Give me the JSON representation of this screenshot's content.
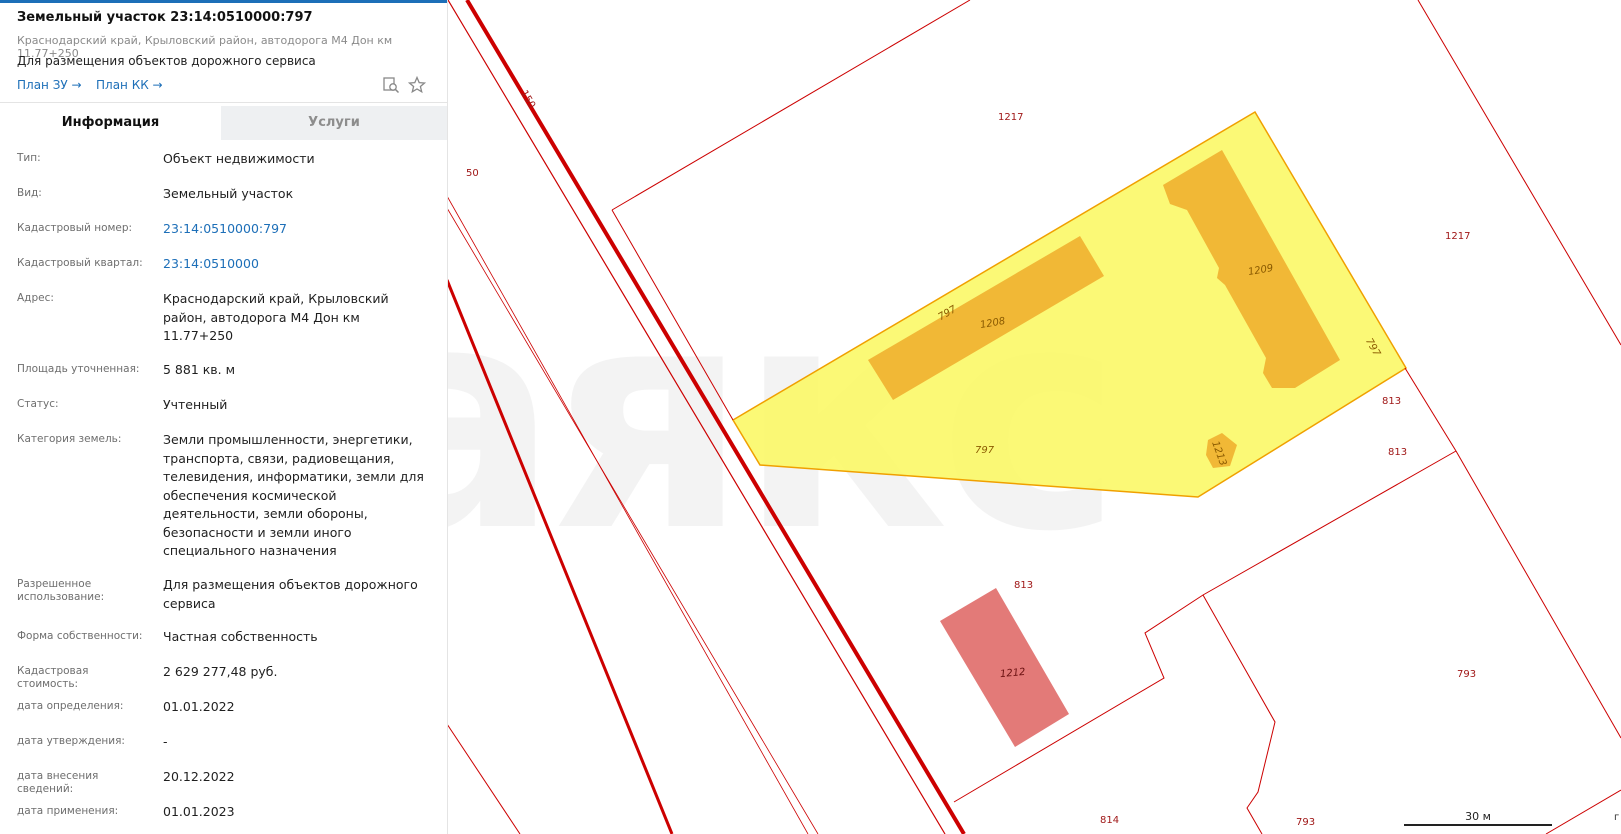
{
  "header": {
    "title": "Земельный участок 23:14:0510000:797",
    "address": "Краснодарский край, Крыловский район, автодорога М4 Дон км 11.77+250",
    "purpose": "Для размещения объектов дорожного сервиса",
    "links": [
      {
        "label": "План ЗУ →"
      },
      {
        "label": "План КК →"
      }
    ],
    "icons": [
      "search-document-icon",
      "star-icon"
    ]
  },
  "tabs": [
    {
      "label": "Информация",
      "active": true
    },
    {
      "label": "Услуги",
      "active": false
    }
  ],
  "rows": [
    {
      "key": "Тип:",
      "value": "Объект недвижимости"
    },
    {
      "key": "Вид:",
      "value": "Земельный участок"
    },
    {
      "key": "Кадастровый номер:",
      "value": "23:14:0510000:797",
      "link": true
    },
    {
      "key": "Кадастровый квартал:",
      "value": "23:14:0510000",
      "link": true
    },
    {
      "key": "Адрес:",
      "value": "Краснодарский край, Крыловский район, автодорога М4 Дон км 11.77+250"
    },
    {
      "key": "Площадь уточненная:",
      "value": "5 881 кв. м"
    },
    {
      "key": "Статус:",
      "value": "Учтенный"
    },
    {
      "key": "Категория земель:",
      "value": "Земли промышленности, энергетики, транспорта, связи, радиовещания, телевидения, информатики, земли для обеспечения космической деятельности, земли обороны, безопасности и земли иного специального назначения"
    },
    {
      "key": "Разрешенное использование:",
      "value": "Для размещения объектов дорожного сервиса"
    },
    {
      "key": "Форма собственности:",
      "value": "Частная собственность"
    },
    {
      "key": "Кадастровая стоимость:",
      "value": "2 629 277,48 руб."
    },
    {
      "key": "дата определения:",
      "value": "01.01.2022"
    },
    {
      "key": "дата утверждения:",
      "value": "-"
    },
    {
      "key": "дата внесения сведений:",
      "value": "20.12.2022"
    },
    {
      "key": "дата применения:",
      "value": "01.01.2023"
    }
  ],
  "map": {
    "watermark": "аякс",
    "labels": [
      "1217",
      "1217",
      "50",
      "150",
      "797",
      "797",
      "797",
      "1208",
      "1209",
      "1213",
      "813",
      "813",
      "813",
      "1212",
      "793",
      "814",
      "793"
    ],
    "scale": "30 м",
    "edge_label": "г",
    "colors": {
      "parcel_border": "#d40000",
      "selected_fill": "#fbf86a",
      "selected_border": "#f0a000",
      "building_fill": "#f0b030",
      "building_red": "#e37a78"
    }
  }
}
